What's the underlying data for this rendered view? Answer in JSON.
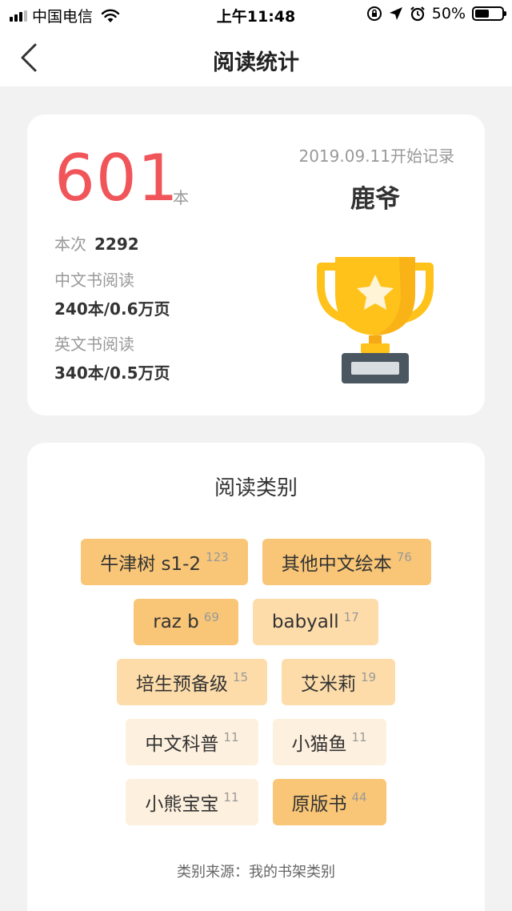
{
  "status_bar": {
    "carrier": "中国电信",
    "time": "上午11:48",
    "battery_percent": "50%",
    "battery_level": 0.5,
    "icons": [
      "signal-icon",
      "wifi-icon",
      "orientation-lock-icon",
      "location-icon",
      "alarm-icon",
      "battery-icon"
    ]
  },
  "nav": {
    "title": "阅读统计",
    "back_icon": "chevron-left-icon"
  },
  "summary": {
    "count": "601",
    "count_unit": "本",
    "since": "2019.09.11开始记录",
    "user_name": "鹿爷",
    "this_time_label": "本次",
    "this_time_value": "2292",
    "chinese_label": "中文书阅读",
    "chinese_value": "240本/0.6万页",
    "english_label": "英文书阅读",
    "english_value": "340本/0.5万页",
    "trophy_icon": "trophy-icon"
  },
  "categories": {
    "title": "阅读类别",
    "rows": [
      [
        {
          "name": "牛津树 s1-2",
          "count": "123",
          "color": "#f9c677"
        },
        {
          "name": "其他中文绘本",
          "count": "76",
          "color": "#f9c677"
        }
      ],
      [
        {
          "name": "raz b",
          "count": "69",
          "color": "#f9c677"
        },
        {
          "name": "babyall",
          "count": "17",
          "color": "#fddcaa"
        }
      ],
      [
        {
          "name": "培生预备级",
          "count": "15",
          "color": "#fddcaa"
        },
        {
          "name": "艾米莉",
          "count": "19",
          "color": "#fddcaa"
        }
      ],
      [
        {
          "name": "中文科普",
          "count": "11",
          "color": "#fef0de"
        },
        {
          "name": "小猫鱼",
          "count": "11",
          "color": "#fef0de"
        }
      ],
      [
        {
          "name": "小熊宝宝",
          "count": "11",
          "color": "#fef0de"
        },
        {
          "name": "原版书",
          "count": "44",
          "color": "#f9c677"
        }
      ]
    ],
    "source_note": "类别来源：我的书架类别"
  },
  "colors": {
    "accent_red": "#f0555a",
    "background": "#f2f2f2",
    "trophy_gold": "#ffc21a"
  }
}
